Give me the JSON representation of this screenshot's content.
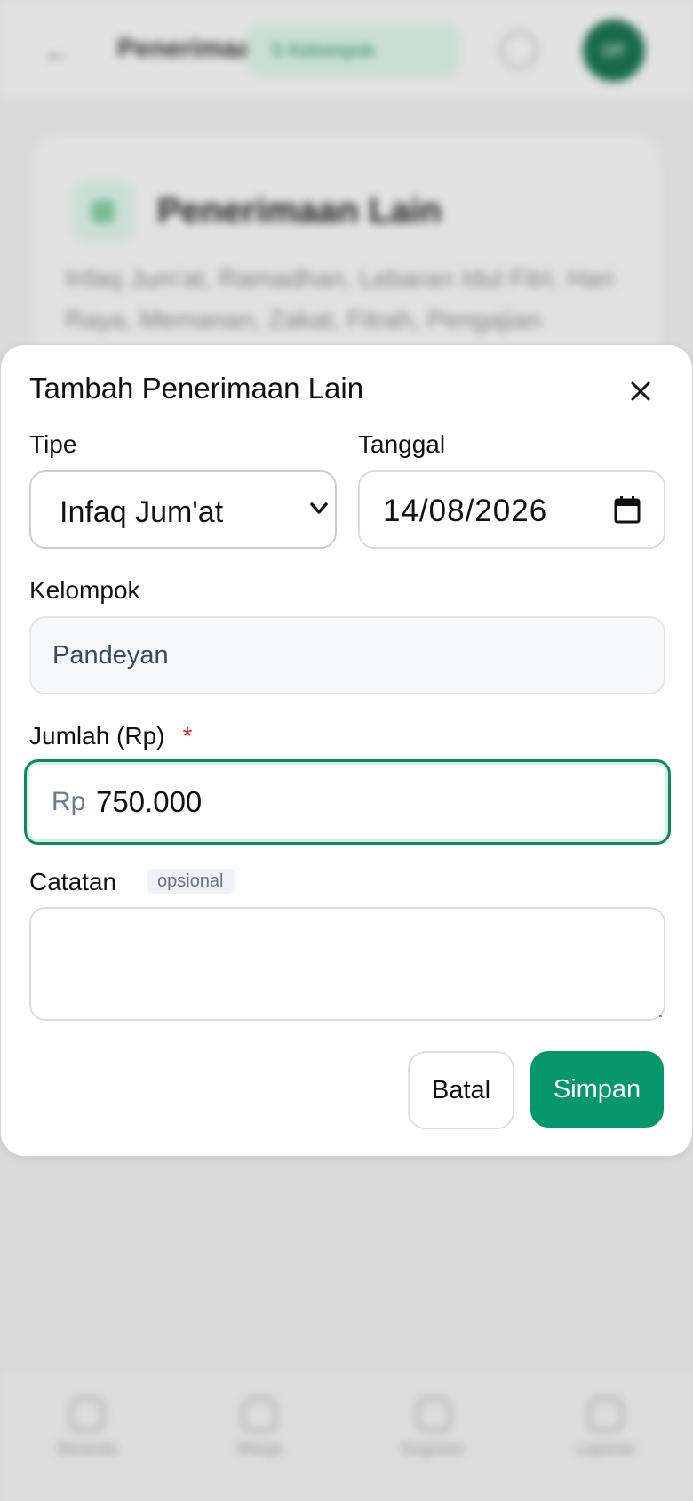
{
  "background": {
    "header": {
      "back_icon": "arrow-left-icon",
      "title": "Penerimaan Lain",
      "pill_label": "5 Kelompok",
      "avatar_initials": "DP"
    },
    "card": {
      "title": "Penerimaan Lain",
      "description": "Infaq Jum'at, Ramadhan, Lebaran Idul Fitri, Hari Raya, Memanan, Zakat, Fitrah, Pengajian"
    },
    "bottom_nav": [
      {
        "label": "Beranda",
        "icon": "home-icon"
      },
      {
        "label": "Warga",
        "icon": "users-icon"
      },
      {
        "label": "Kegiatan",
        "icon": "calendar-icon"
      },
      {
        "label": "Laporan",
        "icon": "report-icon"
      }
    ]
  },
  "modal": {
    "title": "Tambah Penerimaan Lain",
    "close_icon": "close-icon",
    "tipe": {
      "label": "Tipe",
      "value": "Infaq Jum'at"
    },
    "tanggal": {
      "label": "Tanggal",
      "value": "14/08/2026"
    },
    "kelompok": {
      "label": "Kelompok",
      "value": "Pandeyan"
    },
    "jumlah": {
      "label": "Jumlah (Rp)",
      "required_mark": "*",
      "prefix": "Rp",
      "value": "750.000"
    },
    "catatan": {
      "label": "Catatan",
      "badge": "opsional",
      "value": ""
    },
    "cancel_label": "Batal",
    "save_label": "Simpan"
  },
  "colors": {
    "primary": "#059669",
    "focus_border": "#0f8a5e",
    "required": "#e02424"
  }
}
